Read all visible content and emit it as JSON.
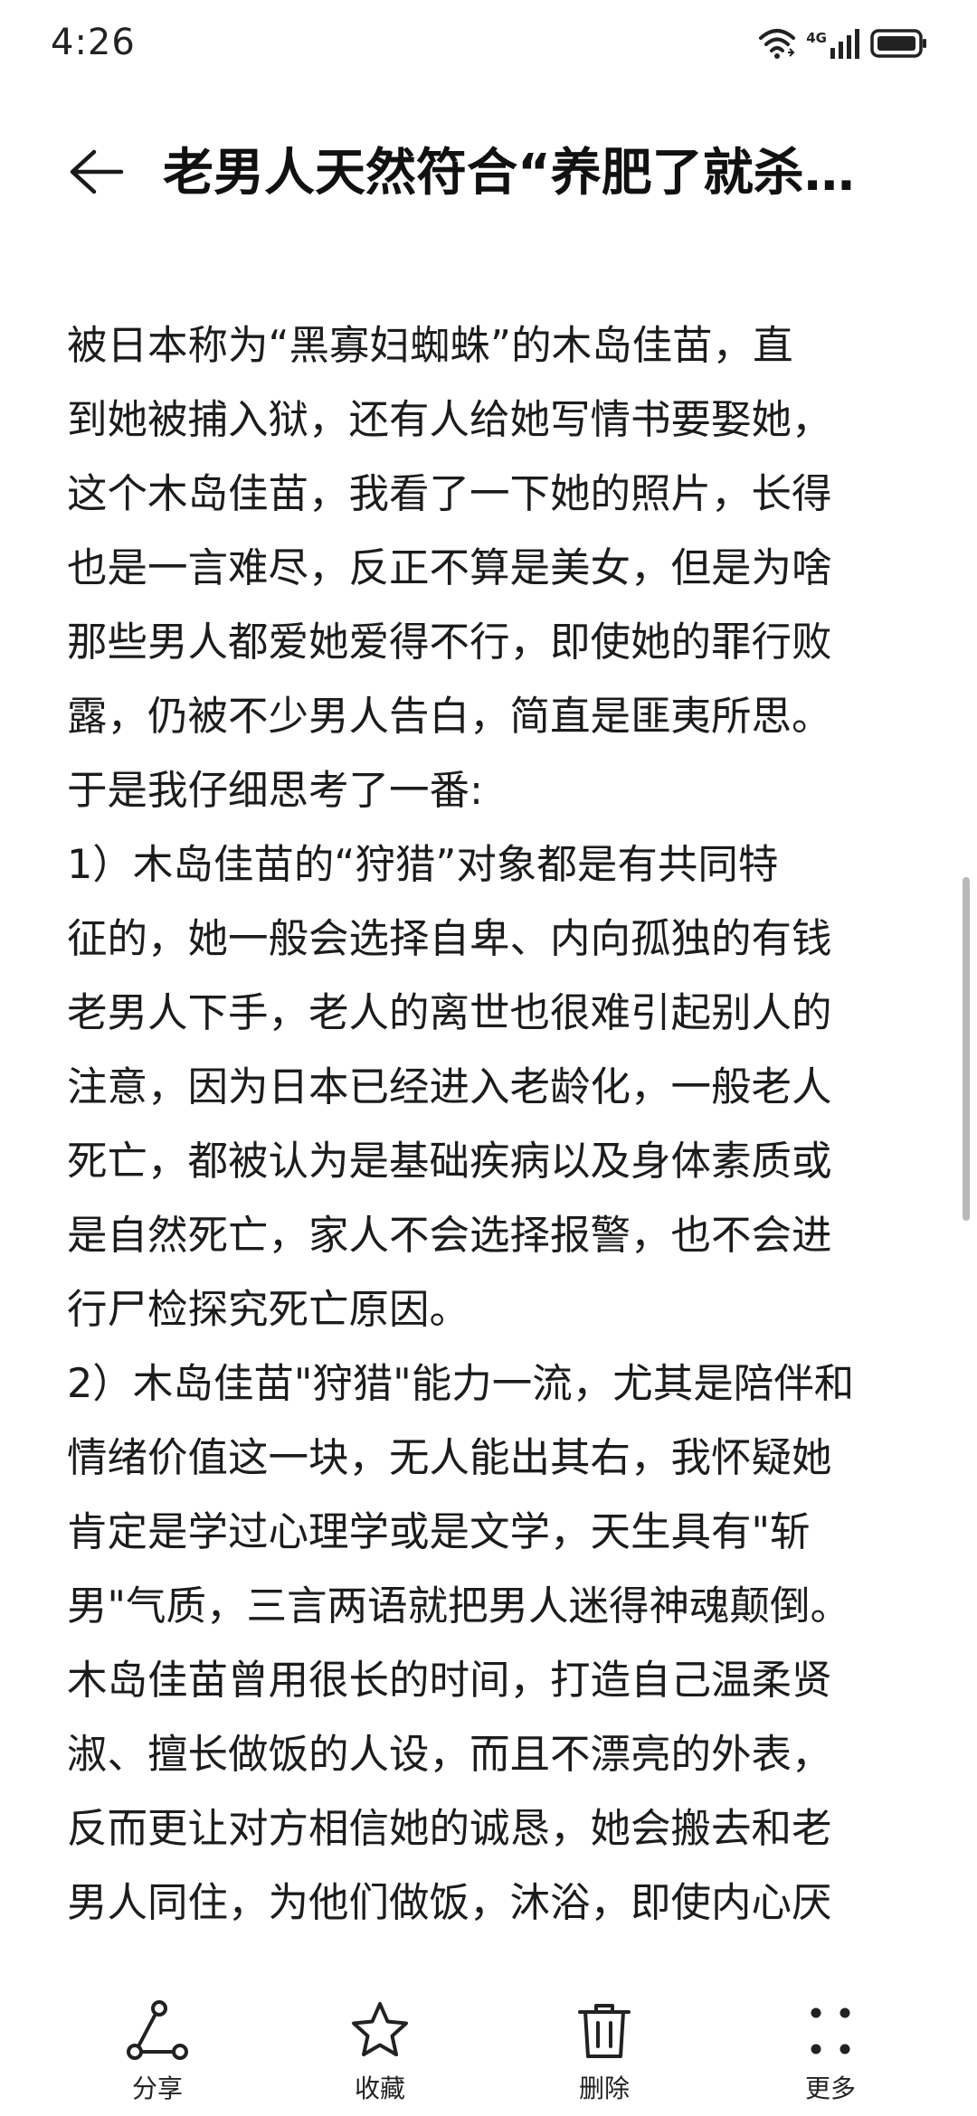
{
  "status_bar": {
    "time": "4:26",
    "network": "4G"
  },
  "header": {
    "title": "老男人天然符合“养肥了就杀…"
  },
  "article": {
    "lines": [
      "被日本称为“黑寡妇蜘蛛”的木岛佳苗，直",
      "到她被捕入狱，还有人给她写情书要娶她，",
      "这个木岛佳苗，我看了一下她的照片，长得",
      "也是一言难尽，反正不算是美女，但是为啥",
      "那些男人都爱她爱得不行，即使她的罪行败",
      "露，仍被不少男人告白，简直是匪夷所思。",
      "于是我仔细思考了一番:",
      "",
      "1）木岛佳苗的“狩猎”对象都是有共同特",
      "征的，她一般会选择自卑、内向孤独的有钱",
      "老男人下手，老人的离世也很难引起别人的",
      "注意，因为日本已经进入老龄化，一般老人",
      "死亡，都被认为是基础疾病以及身体素质或",
      "是自然死亡，家人不会选择报警，也不会进",
      "行尸检探究死亡原因。",
      "2）木岛佳苗\"狩猎\"能力一流，尤其是陪伴和",
      "情绪价值这一块，无人能出其右，我怀疑她",
      "肯定是学过心理学或是文学，天生具有\"斩",
      "男\"气质，三言两语就把男人迷得神魂颠倒。",
      "木岛佳苗曾用很长的时间，打造自己温柔贤",
      "淑、擅长做饭的人设，而且不漂亮的外表，",
      "反而更让对方相信她的诚恳，她会搬去和老",
      "男人同住，为他们做饭，沐浴，即使内心厌"
    ]
  },
  "toolbar": {
    "share": {
      "label": "分享",
      "icon": "share-icon"
    },
    "favorite": {
      "label": "收藏",
      "icon": "star-icon"
    },
    "delete": {
      "label": "删除",
      "icon": "trash-icon"
    },
    "more": {
      "label": "更多",
      "icon": "more-dots-icon"
    }
  }
}
